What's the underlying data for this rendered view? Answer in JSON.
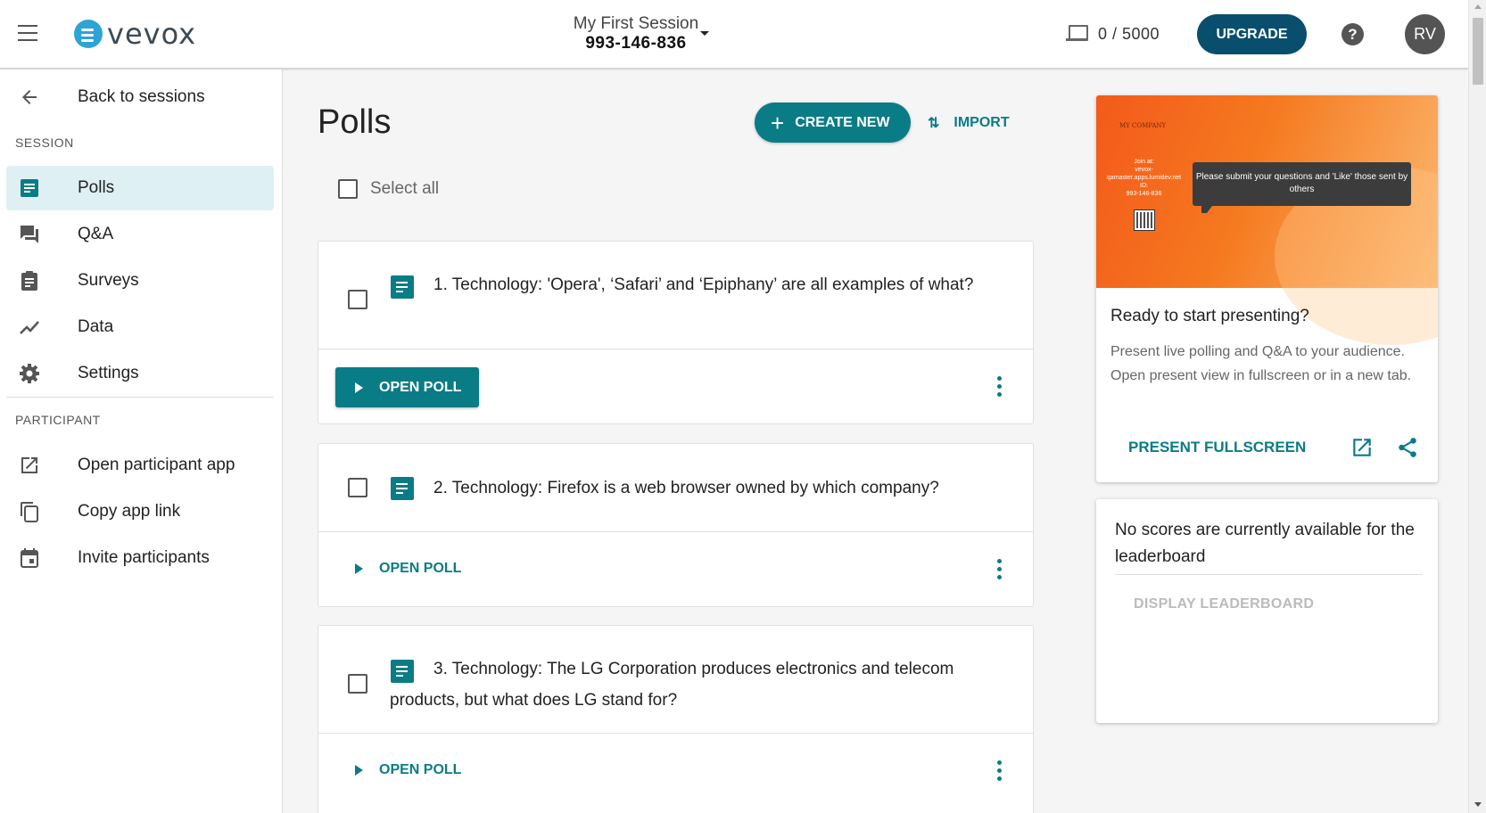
{
  "header": {
    "logo_text": "vevox",
    "session_name": "My First Session",
    "session_id": "993-146-836",
    "device_count": "0 / 5000",
    "upgrade_label": "UPGRADE",
    "help_label": "?",
    "avatar_initials": "RV"
  },
  "sidebar": {
    "back_label": "Back to sessions",
    "section_session": "SESSION",
    "items": [
      {
        "label": "Polls",
        "icon": "polls-icon",
        "active": true
      },
      {
        "label": "Q&A",
        "icon": "qa-icon"
      },
      {
        "label": "Surveys",
        "icon": "surveys-icon"
      },
      {
        "label": "Data",
        "icon": "data-icon"
      },
      {
        "label": "Settings",
        "icon": "gear-icon"
      }
    ],
    "section_participant": "PARTICIPANT",
    "participant_items": [
      {
        "label": "Open participant app",
        "icon": "external-link-icon"
      },
      {
        "label": "Copy app link",
        "icon": "copy-icon"
      },
      {
        "label": "Invite participants",
        "icon": "calendar-icon"
      }
    ]
  },
  "main": {
    "title": "Polls",
    "create_label": "CREATE NEW",
    "import_label": "IMPORT",
    "select_all_label": "Select all",
    "polls": [
      {
        "question": "1. Technology: 'Opera', ‘Safari’ and ‘Epiphany’ are all examples of what?",
        "action": "OPEN POLL"
      },
      {
        "question": "2. Technology: Firefox is a web browser owned by which company?",
        "action": "OPEN POLL"
      },
      {
        "question": "3. Technology: The LG Corporation produces electronics and telecom products, but what does LG stand for?",
        "action": "OPEN POLL"
      }
    ]
  },
  "present": {
    "preview_company": "MY COMPANY",
    "preview_join": "Join at:",
    "preview_url": "vevox-qamaster.apps.lumidev.net",
    "preview_id_label": "ID:",
    "preview_id": "993-146-836",
    "preview_bubble": "Please submit your questions and 'Like' those sent by others",
    "title": "Ready to start presenting?",
    "description": "Present live polling and Q&A to your audience. Open present view in fullscreen or in a new tab.",
    "fullscreen_label": "PRESENT FULLSCREEN"
  },
  "leaderboard": {
    "message": "No scores are currently available for the leaderboard",
    "button_label": "DISPLAY LEADERBOARD"
  },
  "colors": {
    "accent": "#0a7c86",
    "upgrade": "#0a4e6e",
    "active_nav": "#dff0f5"
  }
}
